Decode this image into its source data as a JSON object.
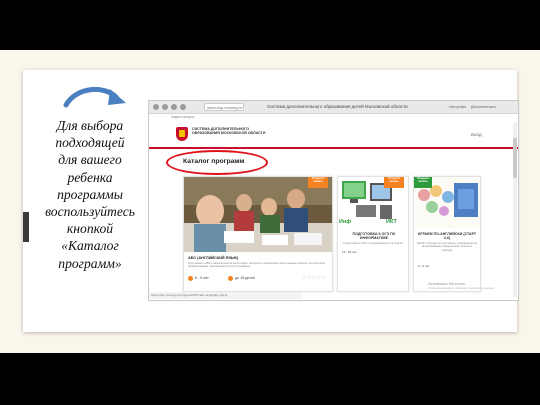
{
  "slide": {
    "caption_lines": [
      "Для выбора",
      "подходящей",
      "для вашего",
      "ребенка",
      "программы",
      "воспользуйтесь",
      "кнопкой",
      "«Каталог",
      "программ»"
    ]
  },
  "browser": {
    "url": "www.dop.mosreg.ru",
    "tab_title": "Система дополнительного образования детей Московской области",
    "btn_settings": "Настройки",
    "btn_extra": "Дополнительно",
    "bookmarks": "Задать вопрос"
  },
  "site": {
    "title": "СИСТЕМА ДОПОЛНИТЕЛЬНОГО ОБРАЗОВАНИЯ МОСКОВСКОЙ ОБЛАСТИ",
    "login": "ВХОД",
    "catalog_heading": "Каталог программ",
    "status_url": "https://dop.mosreg.ru/program/2676-abc-angliyskiy-yazyk",
    "activation": "Активация Windows",
    "activation_sub": "Чтобы активировать Windows, перейдите в раздел..."
  },
  "cards": [
    {
      "badge": "Открыта запись",
      "title": "АБС (АНГЛИЙСКИЙ ЯЗЫК)",
      "description": "Программа «АБС» направлена на воспитание интереса к овладению иностранным языком, способствует формированию гармоничной личности ребёнка",
      "age": "6 - 9 лет",
      "group": "до 15 детей",
      "rating": "☆☆☆☆☆"
    },
    {
      "badge": "Открыта запись",
      "title": "ПОДГОТОВКА К ОГЭ ПО ИНФОРМАТИКЕ",
      "description": "Подготовка к ОГЭ по информатике в 9 классе",
      "age": "14 - 15 лет",
      "logo_left": "Инф",
      "logo_right": "ИКТ"
    },
    {
      "badge": "Открыта запись",
      "title": "ИГРАЕМ ПО-АНГЛИЙСКИ (СТАРТ 4-6)",
      "description": "ДООП «Играем по-английски» направлена на формирование праздничной личности ребенка",
      "age": "4 - 6 лет",
      "corner_label": "ОВЗ"
    }
  ],
  "colors": {
    "accent_red": "#c8102e",
    "oval_red": "#e0131b",
    "badge_orange": "#f58220",
    "arrow_blue": "#4a7fc0"
  },
  "icons": {
    "arrow": "curved-arrow-icon",
    "logo": "moscow-region-emblem-icon"
  }
}
